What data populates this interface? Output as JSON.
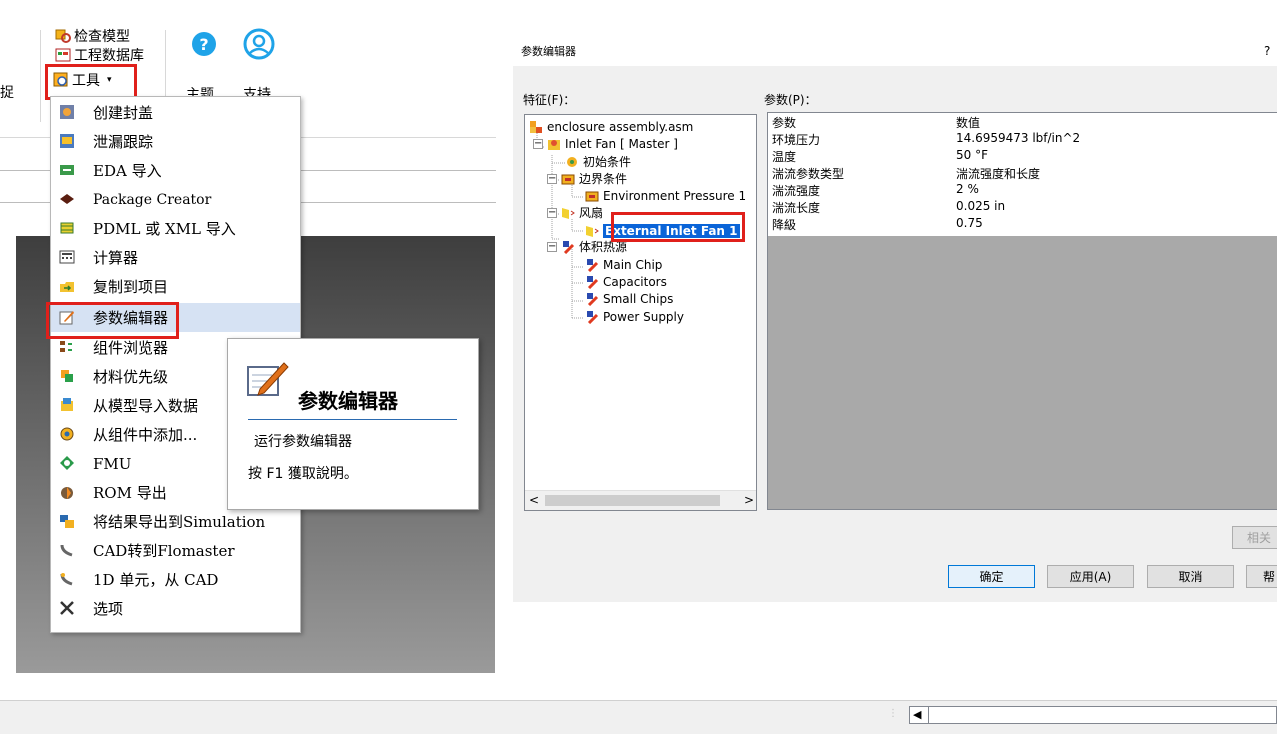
{
  "ribbon": {
    "check_model": "检查模型",
    "engineering_db": "工程数据库",
    "tools_dropdown": "工具",
    "theme": "主题",
    "support": "支持",
    "left_clipped": "捉"
  },
  "tools_menu": {
    "items": [
      {
        "label": "创建封盖"
      },
      {
        "label": "泄漏跟踪"
      },
      {
        "label": "EDA 导入"
      },
      {
        "label": "Package Creator"
      },
      {
        "label": "PDML 或 XML 导入"
      },
      {
        "label": "计算器"
      },
      {
        "label": "复制到项目"
      },
      {
        "label": "参数编辑器"
      },
      {
        "label": "组件浏览器"
      },
      {
        "label": "材料优先级"
      },
      {
        "label": "从模型导入数据"
      },
      {
        "label": "从组件中添加..."
      },
      {
        "label": "FMU"
      },
      {
        "label": "ROM 导出"
      },
      {
        "label": "将结果导出到Simulation"
      },
      {
        "label": "CAD转到Flomaster"
      },
      {
        "label": "1D 单元，从 CAD"
      },
      {
        "label": "选项"
      }
    ]
  },
  "tooltip": {
    "title": "参数编辑器",
    "description": "运行参数编辑器",
    "help": "按 F1 獲取說明。"
  },
  "dialog": {
    "title": "参数编辑器",
    "help_mark": "?",
    "features_label": "特征(F)：",
    "params_label": "参数(P)：",
    "tree": {
      "root": "enclosure assembly.asm",
      "fan_master": "Inlet Fan [ Master ]",
      "initial_conditions": "初始条件",
      "boundary_conditions": "边界条件",
      "environment_pressure": "Environment Pressure 1",
      "fans": "风扇",
      "external_inlet_fan": "External Inlet Fan 1",
      "volume_heat_sources": "体积热源",
      "main_chip": "Main Chip",
      "capacitors": "Capacitors",
      "small_chips": "Small Chips",
      "power_supply": "Power Supply"
    },
    "grid": {
      "header_param": "参数",
      "header_value": "数值",
      "rows": [
        {
          "param": "环境压力",
          "value": "14.6959473 lbf/in^2"
        },
        {
          "param": "温度",
          "value": "50 °F"
        },
        {
          "param": "湍流参数类型",
          "value": "湍流强度和长度"
        },
        {
          "param": "湍流强度",
          "value": "2 %"
        },
        {
          "param": "湍流长度",
          "value": "0.025 in"
        },
        {
          "param": "降級",
          "value": "0.75"
        }
      ]
    },
    "buttons": {
      "related": "相关",
      "ok": "确定",
      "apply": "应用(A)",
      "cancel": "取消",
      "help": "帮"
    }
  },
  "colors": {
    "highlight_red": "#e0201b",
    "selection_blue": "#0a64d8",
    "menu_active": "#d6e2f3"
  }
}
